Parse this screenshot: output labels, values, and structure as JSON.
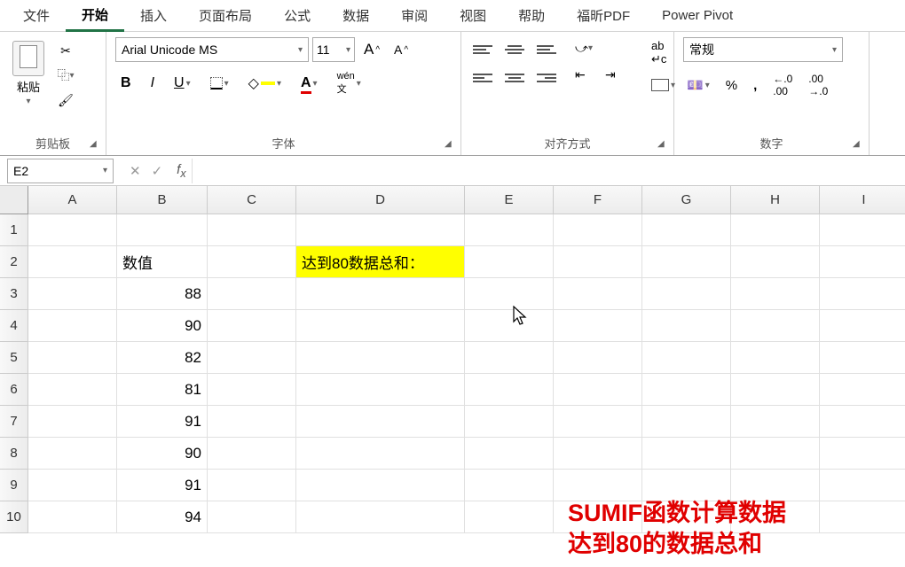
{
  "tabs": [
    "文件",
    "开始",
    "插入",
    "页面布局",
    "公式",
    "数据",
    "审阅",
    "视图",
    "帮助",
    "福昕PDF",
    "Power Pivot"
  ],
  "active_tab": "开始",
  "clipboard": {
    "paste": "粘贴",
    "group": "剪贴板"
  },
  "font": {
    "name": "Arial Unicode MS",
    "size": "11",
    "group": "字体"
  },
  "align": {
    "group": "对齐方式"
  },
  "number": {
    "format": "常规",
    "group": "数字"
  },
  "namebox": "E2",
  "columns": [
    "A",
    "B",
    "C",
    "D",
    "E",
    "F",
    "G",
    "H",
    "I"
  ],
  "rows": [
    "1",
    "2",
    "3",
    "4",
    "5",
    "6",
    "7",
    "8",
    "9",
    "10"
  ],
  "cells": {
    "B2": "数值",
    "B3": "88",
    "B4": "90",
    "B5": "82",
    "B6": "81",
    "B7": "91",
    "B8": "90",
    "B9": "91",
    "B10": "94",
    "D2": "达到80数据总和："
  },
  "overlay": {
    "line1_a": "SUMIF函数计算数据",
    "line2_a": "达到",
    "line2_b": "80",
    "line2_c": "的数据总和"
  }
}
